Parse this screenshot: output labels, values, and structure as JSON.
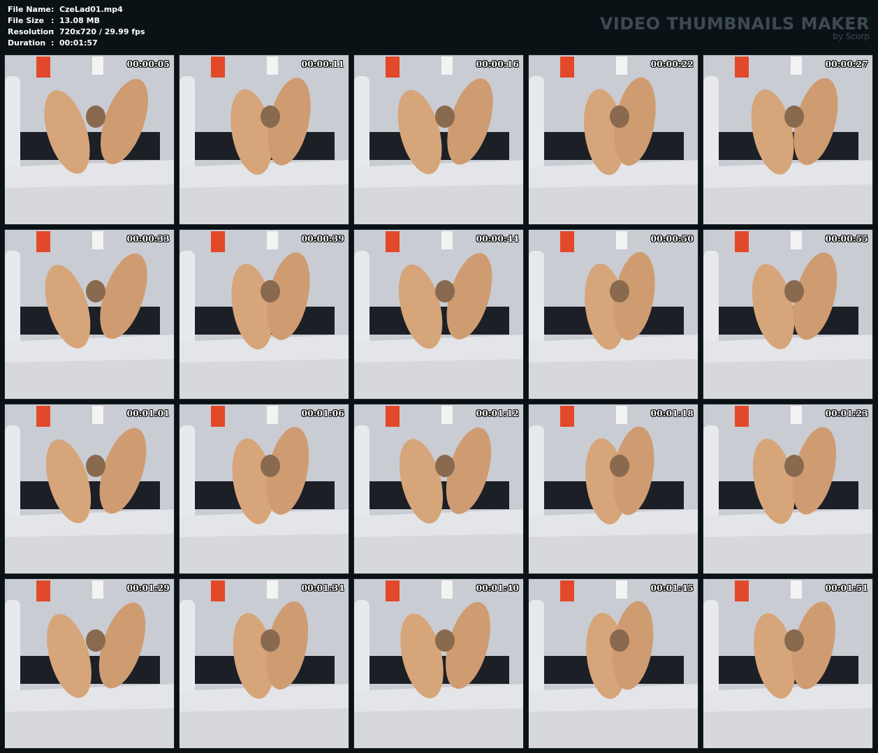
{
  "info": [
    {
      "key": "File Name",
      "value": "CzeLad01.mp4"
    },
    {
      "key": "File Size",
      "value": "13.08 MB"
    },
    {
      "key": "Resolution",
      "value": "720x720 / 29.99 fps"
    },
    {
      "key": "Duration",
      "value": "00:01:57"
    }
  ],
  "brand": {
    "title": "VIDEO THUMBNAILS MAKER",
    "subtitle": "by Scorp"
  },
  "thumbnails": [
    {
      "time": "00:00:05"
    },
    {
      "time": "00:00:11"
    },
    {
      "time": "00:00:16"
    },
    {
      "time": "00:00:22"
    },
    {
      "time": "00:00:27"
    },
    {
      "time": "00:00:33"
    },
    {
      "time": "00:00:39"
    },
    {
      "time": "00:00:44"
    },
    {
      "time": "00:00:50"
    },
    {
      "time": "00:00:55"
    },
    {
      "time": "00:01:01"
    },
    {
      "time": "00:01:06"
    },
    {
      "time": "00:01:12"
    },
    {
      "time": "00:01:18"
    },
    {
      "time": "00:01:23"
    },
    {
      "time": "00:01:29"
    },
    {
      "time": "00:01:34"
    },
    {
      "time": "00:01:40"
    },
    {
      "time": "00:01:45"
    },
    {
      "time": "00:01:51"
    }
  ],
  "colors": {
    "background": "#0b1216",
    "brand": "#3d4a52",
    "wall": "#c9ccd3",
    "bed": "#e4e5e8",
    "skin": "#d6a57a",
    "accent": "#e2492a"
  }
}
